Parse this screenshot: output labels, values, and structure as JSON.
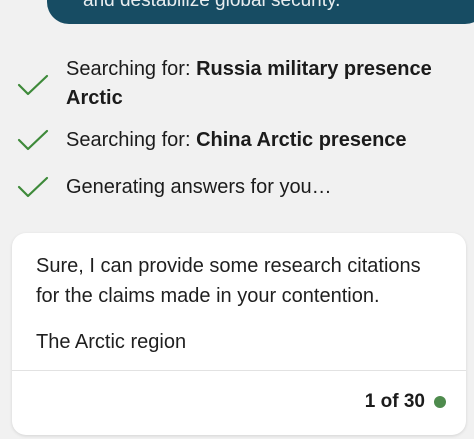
{
  "user_message": {
    "text": "and destabilize global security."
  },
  "status": {
    "items": [
      {
        "prefix": "Searching for: ",
        "query": "Russia military presence Arctic"
      },
      {
        "prefix": "Searching for: ",
        "query": "China Arctic presence"
      },
      {
        "prefix": "Generating answers for you…",
        "query": ""
      }
    ],
    "check_icon": "check-icon",
    "check_color": "#3e8a3a"
  },
  "answer": {
    "paragraph1": "Sure, I can provide some research citations for the claims made in your contention.",
    "paragraph2": "The Arctic region",
    "counter": "1 of 30",
    "dot_color": "#4e8b4d"
  }
}
